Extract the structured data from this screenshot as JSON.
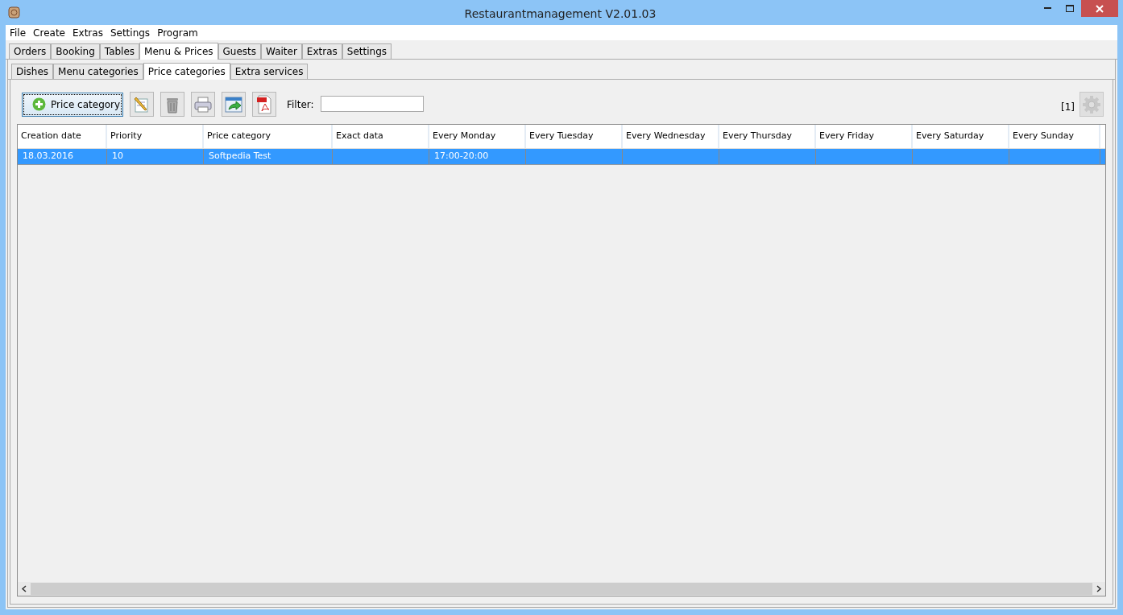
{
  "window": {
    "title": "Restaurantmanagement V2.01.03"
  },
  "menu": [
    "File",
    "Create",
    "Extras",
    "Settings",
    "Program"
  ],
  "tabs": [
    {
      "label": "Orders",
      "selected": false
    },
    {
      "label": "Booking",
      "selected": false
    },
    {
      "label": "Tables",
      "selected": false
    },
    {
      "label": "Menu & Prices",
      "selected": true
    },
    {
      "label": "Guests",
      "selected": false
    },
    {
      "label": "Waiter",
      "selected": false
    },
    {
      "label": "Extras",
      "selected": false
    },
    {
      "label": "Settings",
      "selected": false
    }
  ],
  "subtabs": [
    {
      "label": "Dishes",
      "selected": false
    },
    {
      "label": "Menu categories",
      "selected": false
    },
    {
      "label": "Price categories",
      "selected": true
    },
    {
      "label": "Extra services",
      "selected": false
    }
  ],
  "toolbar": {
    "add_button": "Price category",
    "tools": [
      {
        "kind": "edit"
      },
      {
        "kind": "delete"
      },
      {
        "kind": "print"
      },
      {
        "kind": "export"
      },
      {
        "kind": "pdf"
      }
    ],
    "filter_label": "Filter:",
    "count": "[1]"
  },
  "table": {
    "columns": [
      "Creation date",
      "Priority",
      "Price category",
      "Exact data",
      "Every Monday",
      "Every Tuesday",
      "Every Wednesday",
      "Every Thursday",
      "Every Friday",
      "Every Saturday",
      "Every Sunday"
    ],
    "rows": [
      {
        "selected": true,
        "cells": [
          "18.03.2016",
          "10",
          "Softpedia Test",
          "",
          "17:00-20:00",
          "",
          "",
          "",
          "",
          "",
          ""
        ]
      }
    ]
  }
}
